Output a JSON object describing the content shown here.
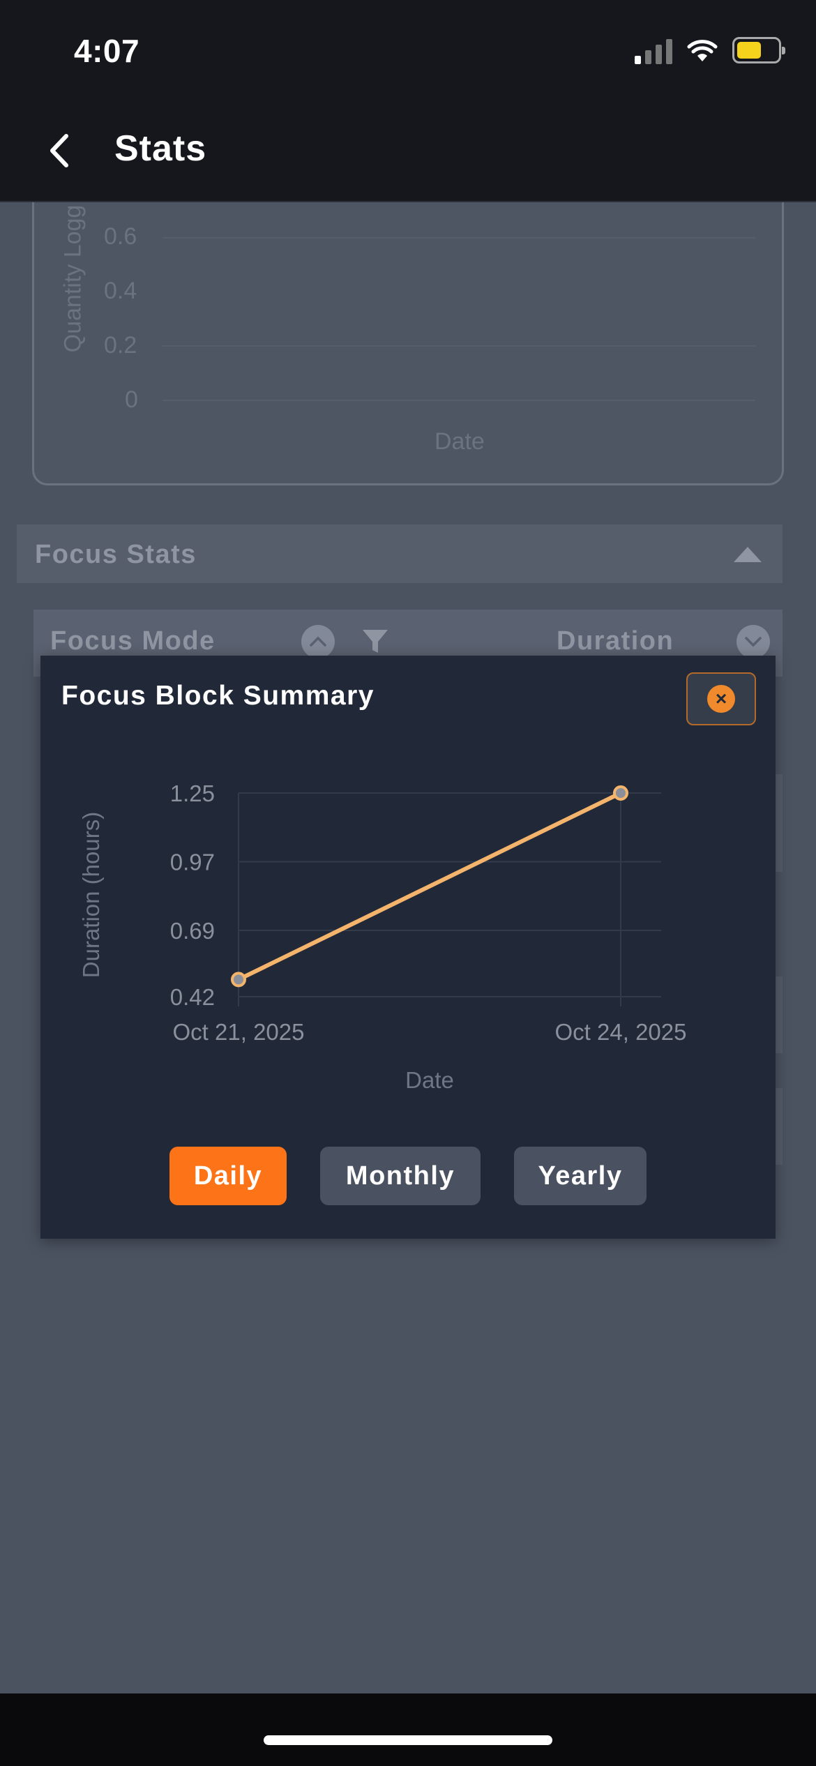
{
  "status_bar": {
    "time": "4:07"
  },
  "header": {
    "title": "Stats"
  },
  "background": {
    "chart": {
      "ylabel": "Quantity Logg",
      "ticks": [
        "0.6",
        "0.4",
        "0.2",
        "0"
      ],
      "xlabel": "Date"
    },
    "focus_stats": {
      "label": "Focus Stats"
    },
    "table_header": {
      "col1": "Focus Mode",
      "col2": "Duration"
    }
  },
  "modal": {
    "title": "Focus Block Summary",
    "buttons": {
      "daily": "Daily",
      "monthly": "Monthly",
      "yearly": "Yearly"
    },
    "active_button": "daily"
  },
  "colors": {
    "accent": "#fc7318",
    "line": "#f4b46c",
    "modal_bg": "#212938",
    "button_inactive": "#4a5160"
  },
  "chart_data": {
    "type": "line",
    "title": "",
    "xlabel": "Date",
    "ylabel": "Duration (hours)",
    "x": [
      "Oct 21, 2025",
      "Oct 24, 2025"
    ],
    "series": [
      {
        "values": [
          0.49,
          1.25
        ]
      }
    ],
    "yticks": [
      "1.25",
      "0.97",
      "0.69",
      "0.42"
    ],
    "ylim": [
      0.42,
      1.25
    ],
    "grid": true
  }
}
